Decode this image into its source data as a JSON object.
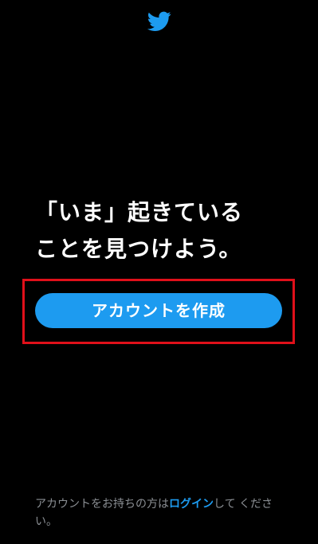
{
  "brand": {
    "logo_icon": "twitter-bird-icon",
    "accent_color": "#1d9bf0",
    "highlight_color": "#e0101a",
    "background_color": "#000000"
  },
  "headline": {
    "line1": "「いま」起きている",
    "line2": "ことを見つけよう。"
  },
  "create_account": {
    "label": "アカウントを作成"
  },
  "footer": {
    "prefix": "アカウントをお持ちの方は",
    "login_label": "ログイン",
    "suffix": "して ください。"
  }
}
